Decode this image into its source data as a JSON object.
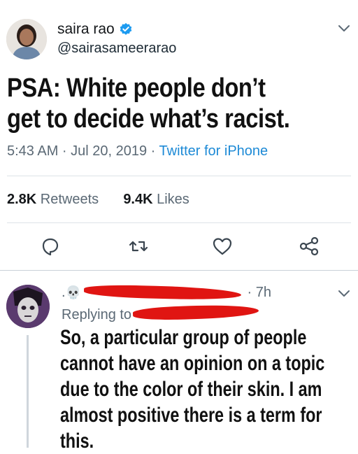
{
  "tweet": {
    "author_name": "saira rao",
    "handle": "@sairasameerarao",
    "text": "PSA: White people don’t get to decide what’s racist.",
    "time": "5:43 AM · Jul 20, 2019 · ",
    "source": "Twitter for iPhone",
    "retweets_count": "2.8K",
    "retweets_label": " Retweets",
    "likes_count": "9.4K",
    "likes_label": " Likes",
    "icons": {
      "verified": "verified-badge-icon",
      "menu": "chevron-down-icon",
      "reply": "reply-icon",
      "retweet": "retweet-icon",
      "like": "heart-icon",
      "share": "share-icon"
    },
    "colors": {
      "accent": "#1d9bf0",
      "muted": "#5b6975"
    }
  },
  "reply": {
    "prefix": ".",
    "age": " · 7h",
    "replying_label": "Replying to ",
    "text": "So, a particular group of people cannot have an opinion on a topic due to the color of their skin. I am almost positive there is a term for this.",
    "redaction_color": "#e01512"
  }
}
